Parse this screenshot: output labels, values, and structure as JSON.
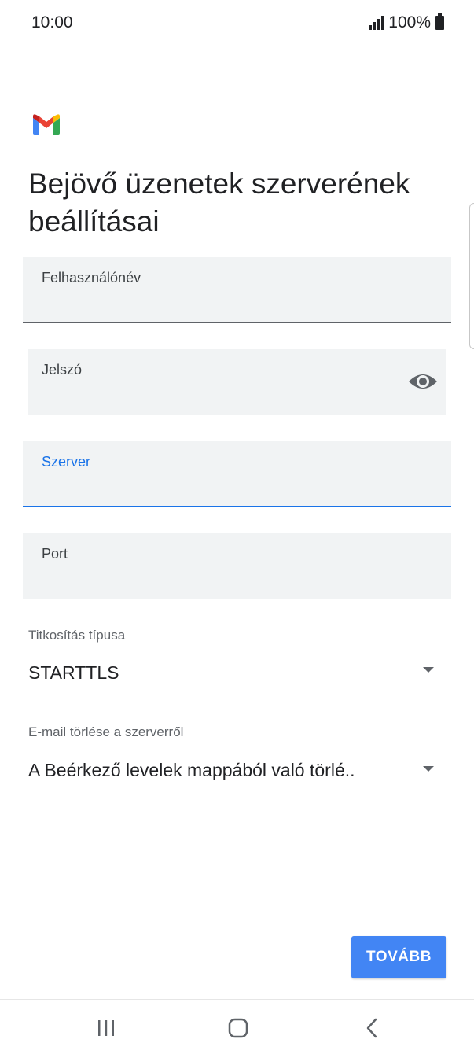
{
  "status_bar": {
    "time": "10:00",
    "battery": "100%",
    "icons": [
      "signal-icon",
      "battery-icon"
    ]
  },
  "app": {
    "logo": "gmail-logo-icon",
    "title": "Bejövő üzenetek szerverének beállításai"
  },
  "form": {
    "username": {
      "label": "Felhasználónév",
      "value": ""
    },
    "password": {
      "label": "Jelszó",
      "value": "",
      "toggle_icon": "eye-icon"
    },
    "server": {
      "label": "Szerver",
      "value": "",
      "focused": true
    },
    "port": {
      "label": "Port",
      "value": ""
    }
  },
  "encryption": {
    "label": "Titkosítás típusa",
    "value": "STARTTLS",
    "icon": "dropdown-arrow-icon"
  },
  "delete_from_server": {
    "label": "E-mail törlése a szerverről",
    "value": "A Beérkező levelek mappából való törlé..",
    "icon": "dropdown-arrow-icon"
  },
  "actions": {
    "next_label": "TOVÁBB"
  },
  "navigation": {
    "icons": [
      "recent-apps-icon",
      "home-icon",
      "back-icon"
    ]
  },
  "colors": {
    "accent": "#1a73e8",
    "button": "#4285f4",
    "field_bg": "#f1f3f4"
  }
}
